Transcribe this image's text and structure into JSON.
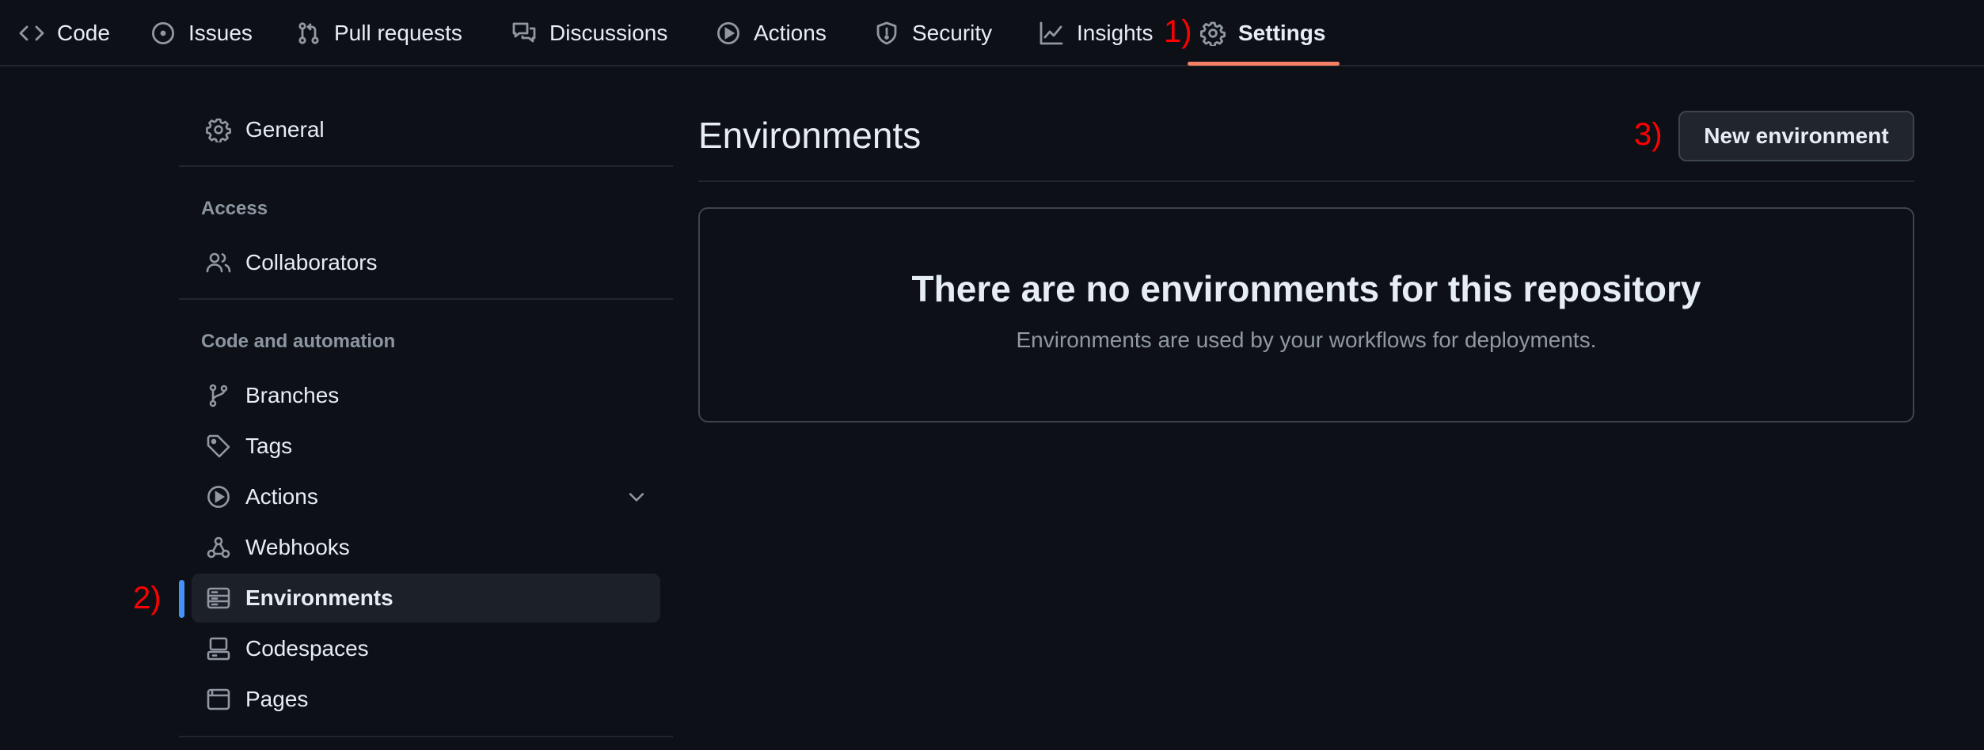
{
  "topnav": {
    "tabs": [
      {
        "label": "Code",
        "icon": "code-icon"
      },
      {
        "label": "Issues",
        "icon": "issue-opened-icon"
      },
      {
        "label": "Pull requests",
        "icon": "git-pull-request-icon"
      },
      {
        "label": "Discussions",
        "icon": "comment-discussion-icon"
      },
      {
        "label": "Actions",
        "icon": "play-icon"
      },
      {
        "label": "Security",
        "icon": "shield-icon"
      },
      {
        "label": "Insights",
        "icon": "graph-icon"
      },
      {
        "label": "Settings",
        "icon": "gear-icon",
        "active": true
      }
    ],
    "active_underline_color": "#f78166"
  },
  "annotations": {
    "one": "1)",
    "two": "2)",
    "three": "3)"
  },
  "sidebar": {
    "general": {
      "label": "General",
      "icon": "gear-icon"
    },
    "access_heading": "Access",
    "collaborators": {
      "label": "Collaborators",
      "icon": "people-icon"
    },
    "code_heading": "Code and automation",
    "items": [
      {
        "label": "Branches",
        "icon": "git-branch-icon"
      },
      {
        "label": "Tags",
        "icon": "tag-icon"
      },
      {
        "label": "Actions",
        "icon": "play-icon",
        "expandable": true
      },
      {
        "label": "Webhooks",
        "icon": "webhook-icon"
      },
      {
        "label": "Environments",
        "icon": "server-icon",
        "active": true
      },
      {
        "label": "Codespaces",
        "icon": "codespaces-icon"
      },
      {
        "label": "Pages",
        "icon": "browser-icon"
      }
    ],
    "active_indicator_color": "#4493f8"
  },
  "main": {
    "title": "Environments",
    "new_button_label": "New environment",
    "blankslate": {
      "title": "There are no environments for this repository",
      "description": "Environments are used by your workflows for deployments."
    }
  },
  "colors": {
    "background": "#0d1117",
    "text": "#e6edf3",
    "muted": "#9198a1",
    "border": "#3d444d"
  }
}
